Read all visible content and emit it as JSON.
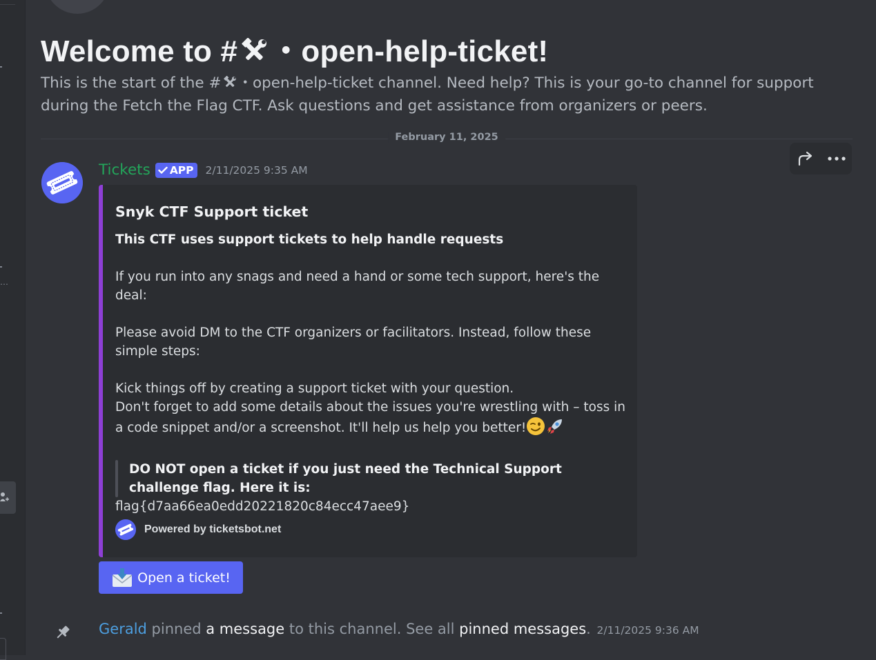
{
  "welcome": {
    "title_prefix": "Welcome to #",
    "title_channel": "・open-help-ticket!",
    "desc_prefix": "This is the start of the #",
    "desc_suffix": "・open-help-ticket channel. Need help? This is your go-to channel for support during the Fetch the Flag CTF. Ask questions and get assistance from organizers or peers.",
    "channel_icon": "hammer-and-wrench-icon"
  },
  "divider": {
    "date": "February 11, 2025"
  },
  "actions": {
    "forward_icon": "forward-icon",
    "more_icon": "more-icon"
  },
  "message": {
    "author": "Tickets",
    "app_tag": "APP",
    "timestamp": "2/11/2025 9:35 AM",
    "author_color": "#23a55a",
    "embed": {
      "accent_color": "#8e3fd6",
      "title": "Snyk CTF Support ticket",
      "heading": "This CTF uses support tickets to help handle requests",
      "p1": "If you run into any snags and need a hand or some tech support, here's the deal:",
      "p2": "Please avoid DM to the CTF organizers or facilitators. Instead, follow these simple steps:",
      "p3_line1": "Kick things off by creating a support ticket with your question.",
      "p3_line2": "Don't forget to add some details about the issues you're wrestling with – toss in a code snippet and/or a screenshot. It'll help us help you better!",
      "quote": "DO NOT open a ticket if you just need the Technical Support challenge flag. Here it is:",
      "flag": "flag{d7aa66ea0edd20221820c84ecc47aee9}",
      "footer": "Powered by ticketsbot.net"
    },
    "button_label": "Open a ticket!",
    "button_color": "#5865f2"
  },
  "pin": {
    "user": "Gerald",
    "text1": " pinned ",
    "link1": "a message",
    "text2": " to this channel. See all ",
    "link2": "pinned messages",
    "text3": ".",
    "timestamp": "2/11/2025 9:36 AM"
  }
}
